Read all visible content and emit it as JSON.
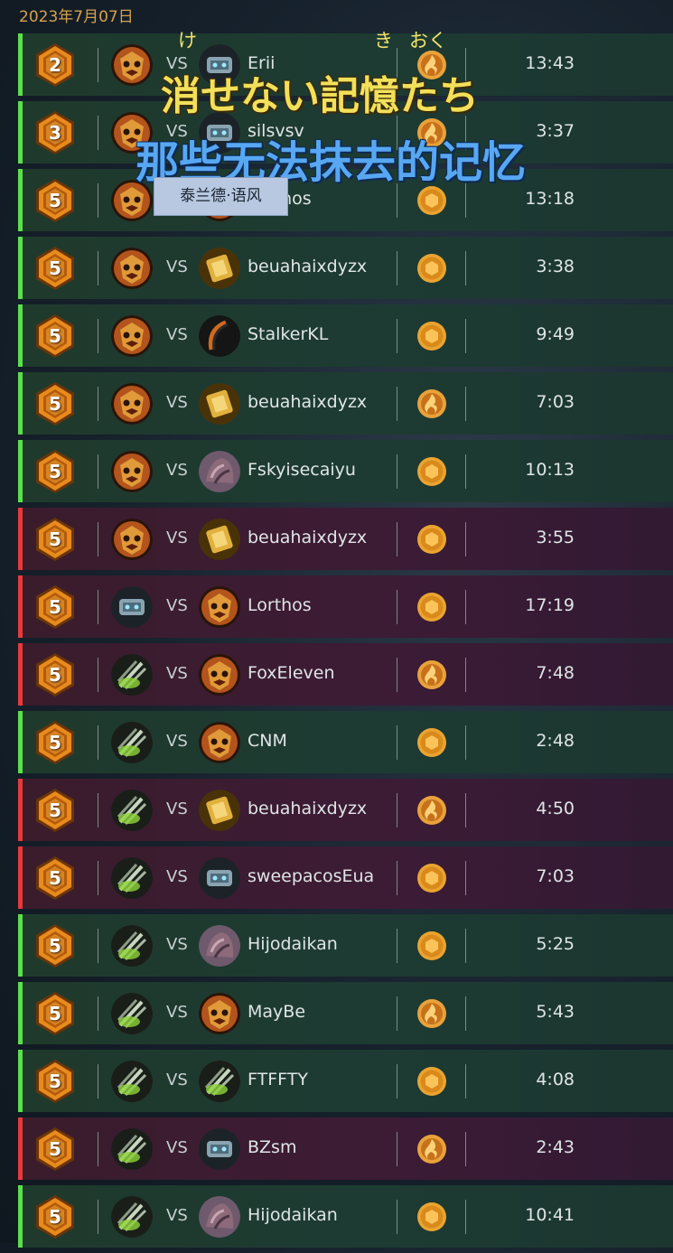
{
  "header": {
    "date": "2023年7月07日"
  },
  "overlay": {
    "ruby": [
      "け",
      "き",
      "おく"
    ],
    "subtitle_jp": "消せない記憶たち",
    "subtitle_cn": "那些无法抹去的记忆",
    "tooltip": "泰兰德·语风"
  },
  "vs_label": "VS",
  "colors": {
    "win": "#59e04a",
    "loss": "#e63a3a",
    "accent": "#d6a24d"
  },
  "matches": [
    {
      "result": "win",
      "rank": "2",
      "my_hero": "tribal-mask",
      "opp_hero": "armored-beast",
      "opponent": "Erii",
      "mode": "flame-coin",
      "time": "13:43"
    },
    {
      "result": "win",
      "rank": "3",
      "my_hero": "tribal-mask",
      "opp_hero": "armored-beast",
      "opponent": "silsvsv",
      "mode": "flame-coin",
      "time": "3:37"
    },
    {
      "result": "win",
      "rank": "5",
      "my_hero": "tribal-mask",
      "opp_hero": "tribal-mask",
      "opponent": "Lorthos",
      "mode": "hex-coin",
      "time": "13:18"
    },
    {
      "result": "win",
      "rank": "5",
      "my_hero": "tribal-mask",
      "opp_hero": "golden-tome",
      "opponent": "beuahaixdyzx",
      "mode": "hex-coin",
      "time": "3:38"
    },
    {
      "result": "win",
      "rank": "5",
      "my_hero": "tribal-mask",
      "opp_hero": "dark-bow",
      "opponent": "StalkerKL",
      "mode": "hex-coin",
      "time": "9:49"
    },
    {
      "result": "win",
      "rank": "5",
      "my_hero": "tribal-mask",
      "opp_hero": "golden-tome",
      "opponent": "beuahaixdyzx",
      "mode": "flame-coin",
      "time": "7:03"
    },
    {
      "result": "win",
      "rank": "5",
      "my_hero": "tribal-mask",
      "opp_hero": "stone-giant",
      "opponent": "Fskyisecaiyu",
      "mode": "hex-coin",
      "time": "10:13"
    },
    {
      "result": "loss",
      "rank": "5",
      "my_hero": "tribal-mask",
      "opp_hero": "golden-tome",
      "opponent": "beuahaixdyzx",
      "mode": "hex-coin",
      "time": "3:55"
    },
    {
      "result": "loss",
      "rank": "5",
      "my_hero": "armored-beast",
      "opp_hero": "tribal-mask",
      "opponent": "Lorthos",
      "mode": "hex-coin",
      "time": "17:19"
    },
    {
      "result": "loss",
      "rank": "5",
      "my_hero": "green-claw",
      "opp_hero": "tribal-mask",
      "opponent": "FoxEleven",
      "mode": "flame-coin",
      "time": "7:48"
    },
    {
      "result": "win",
      "rank": "5",
      "my_hero": "green-claw",
      "opp_hero": "tribal-mask",
      "opponent": "CNM",
      "mode": "hex-coin",
      "time": "2:48"
    },
    {
      "result": "loss",
      "rank": "5",
      "my_hero": "green-claw",
      "opp_hero": "golden-tome",
      "opponent": "beuahaixdyzx",
      "mode": "flame-coin",
      "time": "4:50"
    },
    {
      "result": "loss",
      "rank": "5",
      "my_hero": "green-claw",
      "opp_hero": "armored-beast",
      "opponent": "sweepacosEua",
      "mode": "hex-coin",
      "time": "7:03"
    },
    {
      "result": "win",
      "rank": "5",
      "my_hero": "green-claw",
      "opp_hero": "stone-giant",
      "opponent": "Hijodaikan",
      "mode": "hex-coin",
      "time": "5:25"
    },
    {
      "result": "win",
      "rank": "5",
      "my_hero": "green-claw",
      "opp_hero": "tribal-mask",
      "opponent": "MayBe",
      "mode": "flame-coin",
      "time": "5:43"
    },
    {
      "result": "win",
      "rank": "5",
      "my_hero": "green-claw",
      "opp_hero": "green-claw",
      "opponent": "FTFFTY",
      "mode": "hex-coin",
      "time": "4:08"
    },
    {
      "result": "loss",
      "rank": "5",
      "my_hero": "green-claw",
      "opp_hero": "armored-beast",
      "opponent": "BZsm",
      "mode": "flame-coin",
      "time": "2:43"
    },
    {
      "result": "win",
      "rank": "5",
      "my_hero": "green-claw",
      "opp_hero": "stone-giant",
      "opponent": "Hijodaikan",
      "mode": "hex-coin",
      "time": "10:41"
    }
  ]
}
